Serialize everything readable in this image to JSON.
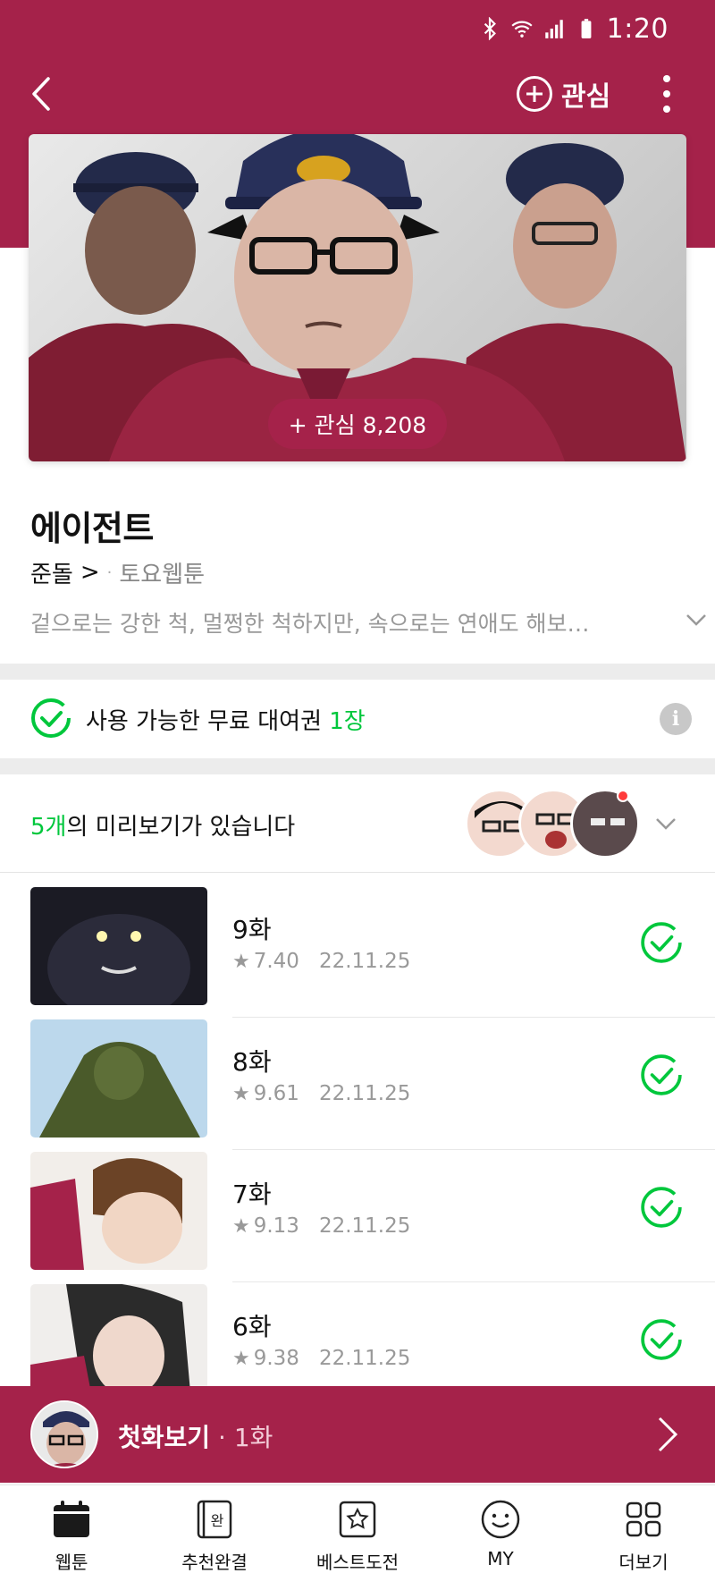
{
  "status_bar": {
    "time": "1:20"
  },
  "header": {
    "fav_label": "관심"
  },
  "cover": {
    "fav_badge": "+ 관심 8,208"
  },
  "webtoon": {
    "title": "에이전트",
    "author": "준돌",
    "author_arrow": ">",
    "separator": "·",
    "day": "토요웹툰",
    "description": "겉으로는 강한 척, 멀쩡한 척하지만, 속으로는 연애도 해보고 ..."
  },
  "rental": {
    "prefix": "사용 가능한 무료 대여권 ",
    "count": "1장",
    "info_icon": "i"
  },
  "preview": {
    "count": "5개",
    "suffix": "의 미리보기가 있습니다"
  },
  "episodes": [
    {
      "title": "9화",
      "rating": "7.40",
      "date": "22.11.25"
    },
    {
      "title": "8화",
      "rating": "9.61",
      "date": "22.11.25"
    },
    {
      "title": "7화",
      "rating": "9.13",
      "date": "22.11.25"
    },
    {
      "title": "6화",
      "rating": "9.38",
      "date": "22.11.25"
    }
  ],
  "first_view": {
    "label": "첫화보기",
    "separator": " · ",
    "episode": "1화"
  },
  "bottom_nav": [
    {
      "label": "웹툰",
      "icon": "calendar-icon"
    },
    {
      "label": "추천완결",
      "icon": "book-icon",
      "icon_text": "완"
    },
    {
      "label": "베스트도전",
      "icon": "star-box-icon"
    },
    {
      "label": "MY",
      "icon": "smile-icon"
    },
    {
      "label": "더보기",
      "icon": "grid-icon"
    }
  ],
  "colors": {
    "brand": "#A5224A",
    "accent_green": "#00C73C"
  }
}
